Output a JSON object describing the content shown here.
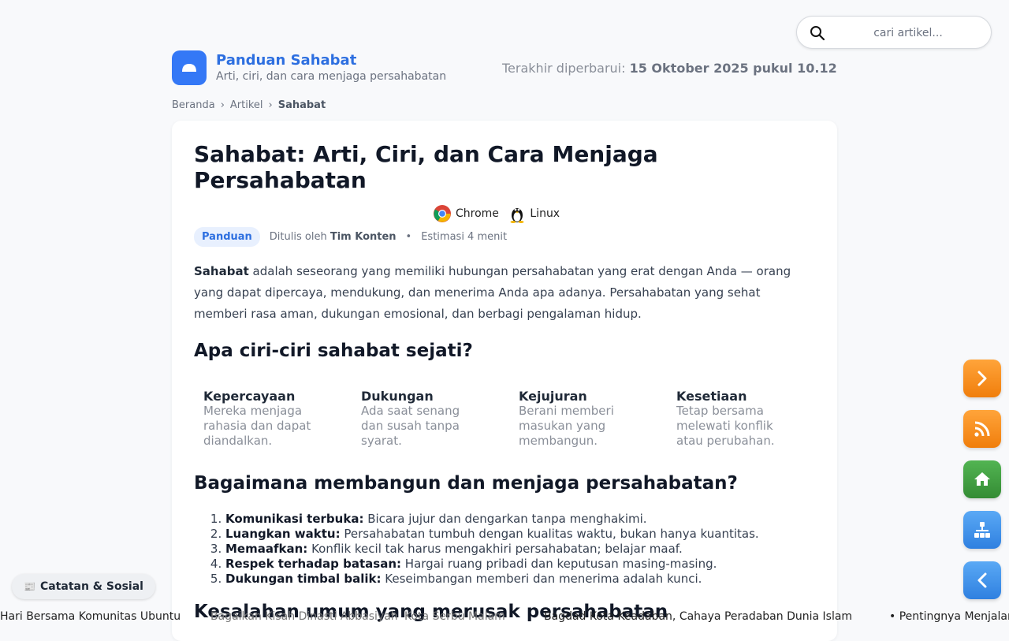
{
  "search": {
    "placeholder": "cari artikel..."
  },
  "site": {
    "title": "Panduan Sahabat",
    "tagline": "Arti, ciri, dan cara menjaga persahabatan",
    "updated_label": "Terakhir diperbarui:",
    "updated_value": "15 Oktober 2025 pukul 10.12"
  },
  "breadcrumb": {
    "items": [
      "Beranda",
      "Artikel",
      "Sahabat"
    ]
  },
  "article": {
    "title": "Sahabat: Arti, Ciri, dan Cara Menjaga Persahabatan",
    "os": [
      "Chrome",
      "Linux"
    ],
    "badge": "Panduan",
    "written_by_label": "Ditulis oleh",
    "author": "Tim Konten",
    "reading_time": "Estimasi 4 menit",
    "intro_term": "Sahabat",
    "intro_text": "adalah seseorang yang memiliki hubungan persahabatan yang erat dengan Anda — orang yang dapat dipercaya, mendukung, dan menerima Anda apa adanya. Persahabatan yang sehat memberi rasa aman, dukungan emosional, dan berbagi pengalaman hidup.",
    "h2_traits": "Apa ciri-ciri sahabat sejati?",
    "traits": [
      {
        "title": "Kepercayaan",
        "desc": "Mereka menjaga rahasia dan dapat diandalkan."
      },
      {
        "title": "Dukungan",
        "desc": "Ada saat senang dan susah tanpa syarat."
      },
      {
        "title": "Kejujuran",
        "desc": "Berani memberi masukan yang membangun."
      },
      {
        "title": "Kesetiaan",
        "desc": "Tetap bersama melewati konflik atau perubahan."
      }
    ],
    "h2_build": "Bagaimana membangun dan menjaga persahabatan?",
    "steps": [
      {
        "bold": "Komunikasi terbuka:",
        "text": "Bicara jujur dan dengarkan tanpa menghakimi."
      },
      {
        "bold": "Luangkan waktu:",
        "text": "Persahabatan tumbuh dengan kualitas waktu, bukan hanya kuantitas."
      },
      {
        "bold": "Memaafkan:",
        "text": "Konflik kecil tak harus mengakhiri persahabatan; belajar maaf."
      },
      {
        "bold": "Respek terhadap batasan:",
        "text": "Hargai ruang pribadi dan keputusan masing-masing."
      },
      {
        "bold": "Dukungan timbal balik:",
        "text": "Keseimbangan memberi dan menerima adalah kunci."
      }
    ],
    "h2_mistakes": "Kesalahan umum yang merusak persahabatan"
  },
  "notes_chip": {
    "label": "Catatan & Sosial"
  },
  "ticker": {
    "items": [
      "Hari Bersama Komunitas Ubuntu",
      "Bagaikan Kisah Dinasti Abbasiyah",
      "Kota Serbu Malam",
      "Bagdad Kota Keadaban, Cahaya Peradaban Dunia Islam",
      "• Pentingnya Menjalani"
    ]
  },
  "side_buttons": [
    "next",
    "rss",
    "home",
    "sitemap",
    "back"
  ],
  "colors": {
    "accent": "#2d6fe0",
    "orange": "#f7901e",
    "green": "#3f9e3f",
    "blue": "#3b8eea"
  }
}
